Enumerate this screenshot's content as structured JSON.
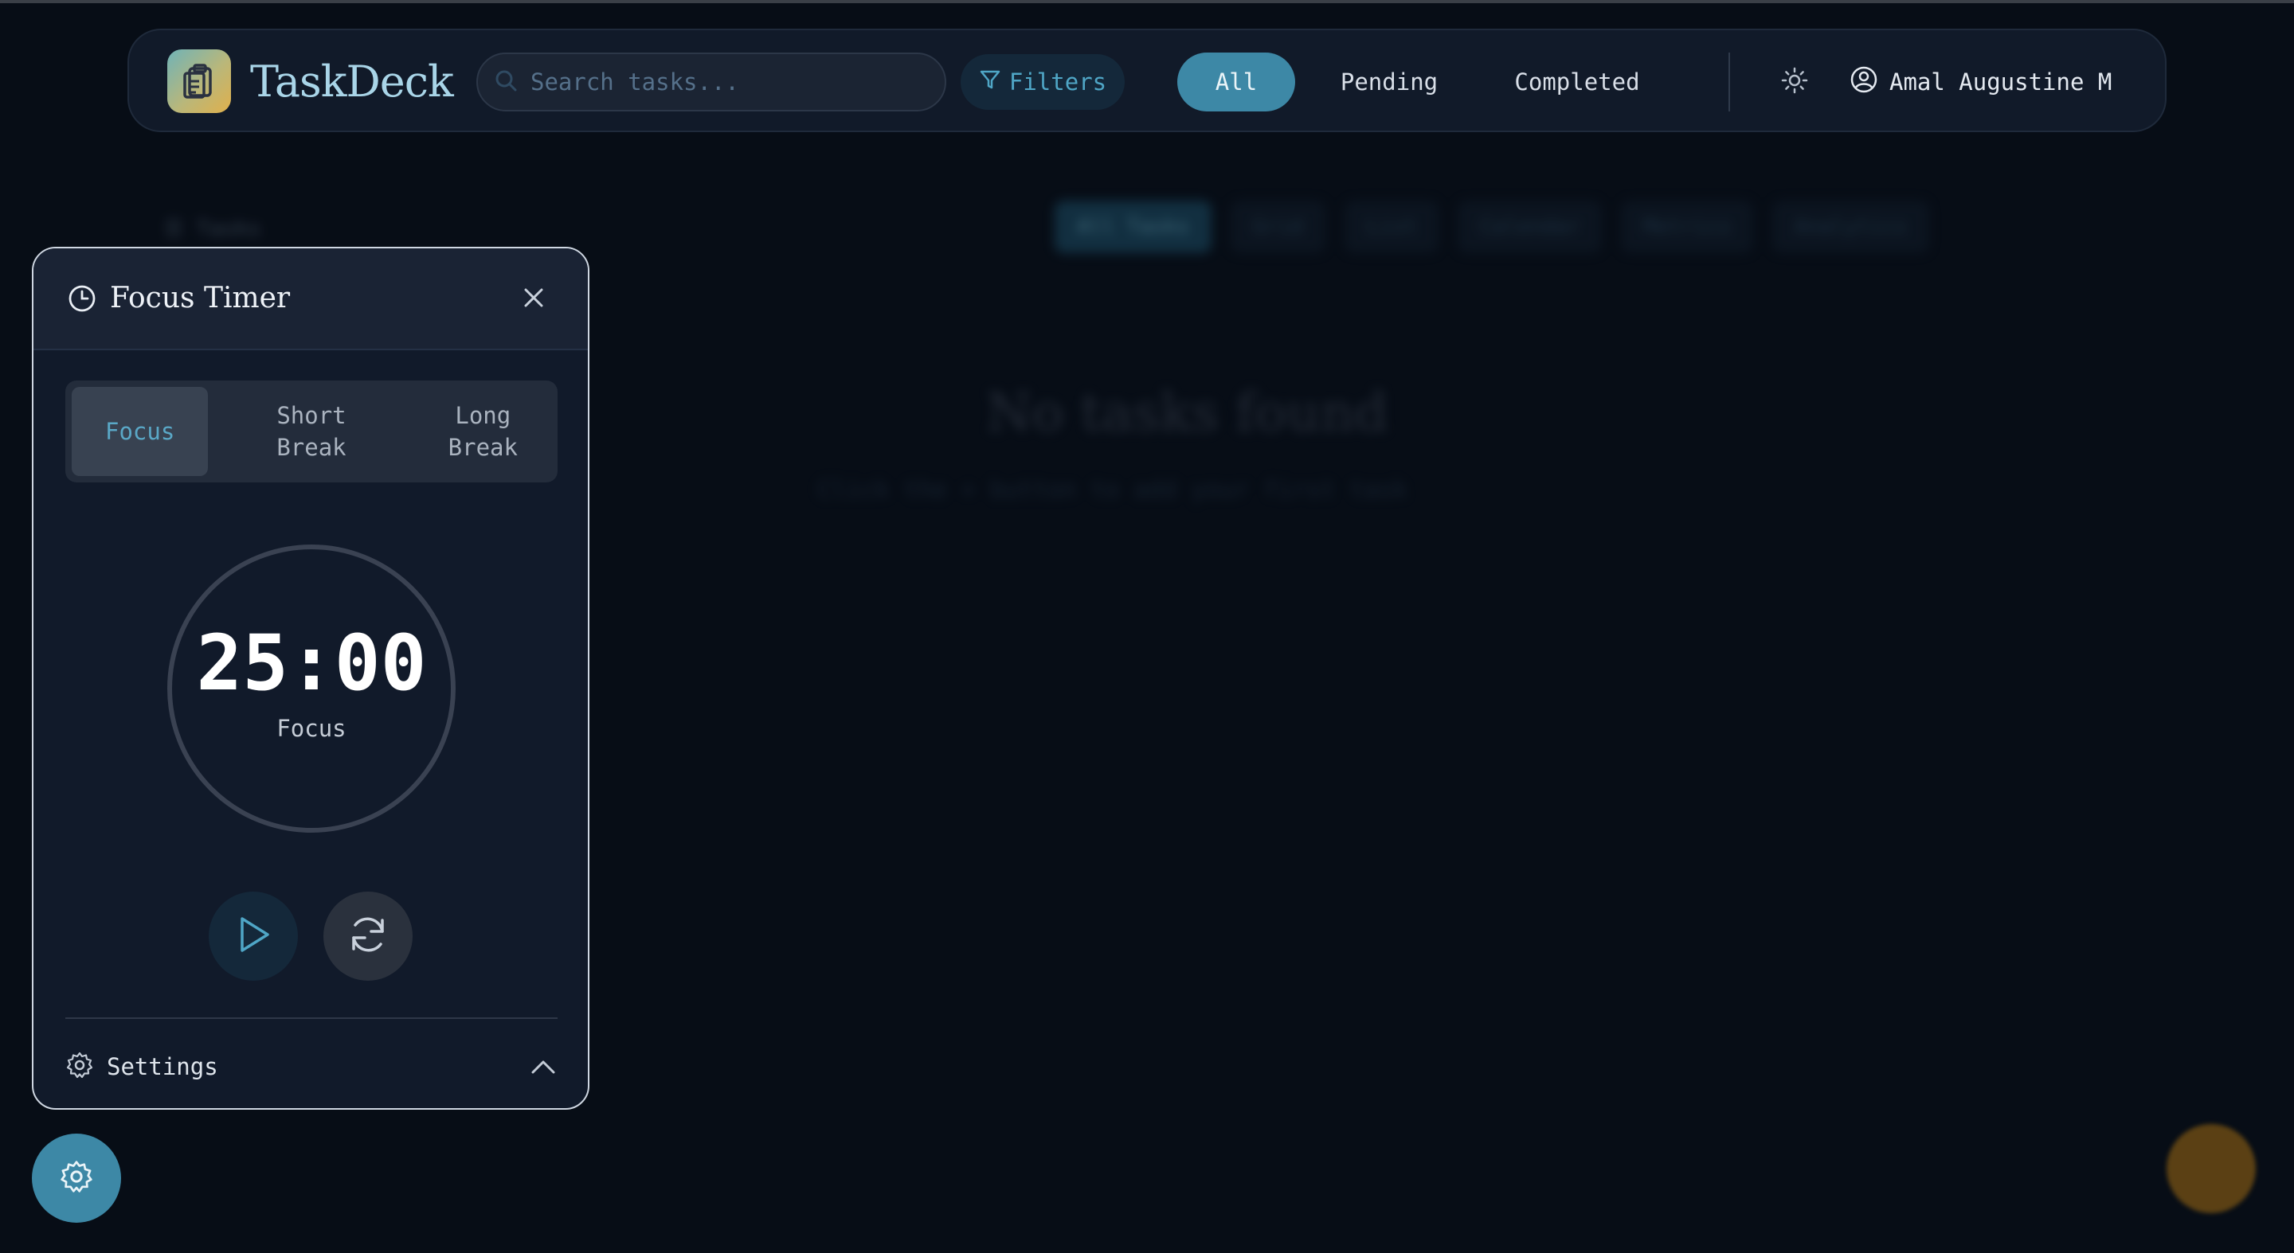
{
  "app": {
    "name": "TaskDeck"
  },
  "header": {
    "search_placeholder": "Search tasks...",
    "filters_label": "Filters",
    "status_tabs": [
      {
        "label": "All",
        "active": true
      },
      {
        "label": "Pending",
        "active": false
      },
      {
        "label": "Completed",
        "active": false
      }
    ],
    "theme_icon": "sun-icon",
    "user_icon": "user-circle-icon",
    "user_name": "Amal Augustine M"
  },
  "background": {
    "view_tabs": [
      "All Tasks",
      "Grid",
      "List",
      "Calendar",
      "Metrics",
      "Analytics"
    ],
    "empty_title": "No tasks found",
    "empty_subtitle": "Click the + button to add your first task"
  },
  "timer_panel": {
    "title": "Focus Timer",
    "title_icon": "clock-icon",
    "close_icon": "close-icon",
    "modes": [
      {
        "label": "Focus",
        "active": true
      },
      {
        "label": "Short Break",
        "active": false
      },
      {
        "label": "Long Break",
        "active": false
      }
    ],
    "time": "25:00",
    "time_label": "Focus",
    "play_icon": "play-icon",
    "reset_icon": "refresh-icon",
    "settings_label": "Settings",
    "settings_icon": "gear-icon",
    "settings_chevron": "chevron-up-icon"
  },
  "fab": {
    "settings_icon": "gear-icon"
  },
  "colors": {
    "accent": "#3d88a6",
    "accent_text": "#5aa8c7",
    "background": "#070d16",
    "panel": "#111a2a"
  }
}
